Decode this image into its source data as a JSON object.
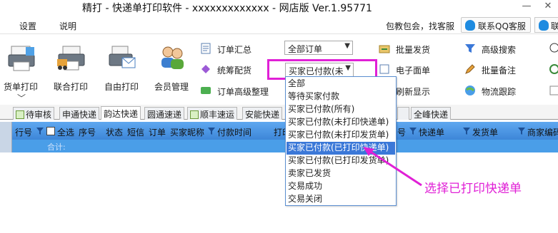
{
  "window": {
    "title": "精打 - 快递单打印软件 - xxxxxxxxxxxxx - 网店版 Ver.1.95771",
    "minimize": "—",
    "close": "✕"
  },
  "menu": {
    "settings": "设置",
    "about": "说明",
    "promo": "包教包会，找客服",
    "qq_support": "联系QQ客服",
    "qq_support2": "联系"
  },
  "ribbon": {
    "big_buttons": [
      "货单打印",
      "联合打印",
      "自由打印",
      "会员管理"
    ],
    "order_summary": "订单汇总",
    "combined_ship": "统筹配货",
    "advanced_org": "订单高级整理",
    "combo_all_orders": "全部订单",
    "combo_status": "买家已付款(未",
    "batch_ship": "批量发货",
    "e_waybill": "电子面单",
    "refresh": "刷新显示",
    "adv_search": "高级搜索",
    "batch_note": "批量备注",
    "logistics": "物流跟踪"
  },
  "tabs": [
    "待审核",
    "申通快递",
    "韵达快递",
    "圆通速递",
    "顺丰速运",
    "安能快递",
    "",
    "全峰快递"
  ],
  "grid": {
    "columns": [
      "行号",
      "全选",
      "序号",
      "状态",
      "短信",
      "订单",
      "买家昵称",
      "付款时间",
      "打印",
      "号",
      "快递单",
      "发货单",
      "商家编码"
    ],
    "total_label": "合计:"
  },
  "dropdown": {
    "options": [
      "全部",
      "等待买家付款",
      "买家已付款(所有)",
      "买家已付款(未打印快递单)",
      "买家已付款(未打印发货单)",
      "买家已付款(已打印快递单)",
      "买家已付款(已打印发货单)",
      "卖家已发货",
      "交易成功",
      "交易关闭"
    ],
    "selected_index": 5
  },
  "annotation": "选择已打印快递单",
  "colors": {
    "accent": "#e020d6",
    "header_blue": "#4a9ee8",
    "selected": "#3b78d8"
  }
}
